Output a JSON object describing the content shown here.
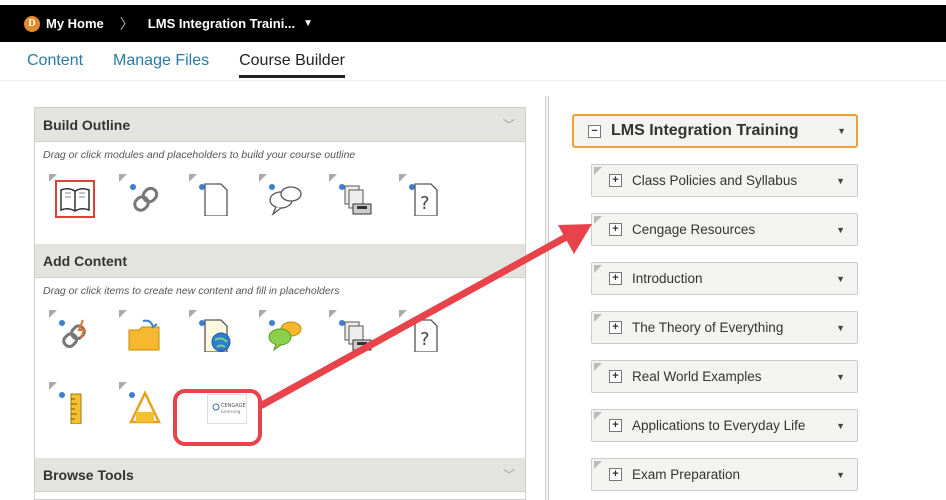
{
  "topbar": {
    "home_logo_letter": "D",
    "home_label": "My Home",
    "separator": "〉",
    "course_label": "LMS Integration Traini...",
    "course_caret": "▼"
  },
  "tabs": [
    {
      "label": "Content",
      "active": false
    },
    {
      "label": "Manage Files",
      "active": false
    },
    {
      "label": "Course Builder",
      "active": true
    }
  ],
  "build_outline": {
    "title": "Build Outline",
    "hint": "Drag or click modules and placeholders to build your course outline",
    "tools": [
      "book-icon",
      "link-icon",
      "document-icon",
      "discussion-icon",
      "dropbox-icon",
      "quiz-icon"
    ]
  },
  "add_content": {
    "title": "Add Content",
    "hint": "Drag or click items to create new content and fill in placeholders",
    "tools_row1": [
      "quicklink-icon",
      "upload-folder-icon",
      "web-link-icon",
      "discussion-icon",
      "dropbox-icon",
      "quiz-icon"
    ],
    "tools_row2": [
      "ruler-icon",
      "survey-icon",
      "cengage-learning-icon"
    ],
    "cengage_text_1": "CENGAGE",
    "cengage_text_2": "Learning"
  },
  "browse_tools": {
    "title": "Browse Tools"
  },
  "outline": {
    "root": {
      "label": "LMS Integration Training",
      "toggle": "−"
    },
    "modules": [
      {
        "label": "Class Policies and Syllabus"
      },
      {
        "label": "Cengage Resources"
      },
      {
        "label": "Introduction"
      },
      {
        "label": "The Theory of Everything"
      },
      {
        "label": "Real World Examples"
      },
      {
        "label": "Applications to Everyday Life"
      },
      {
        "label": "Exam Preparation"
      }
    ],
    "module_toggle": "+",
    "dropdown_glyph": "▼"
  },
  "colors": {
    "accent_orange": "#f0a030",
    "annotation_red": "#e8434a",
    "link_blue": "#2a7aa8"
  }
}
